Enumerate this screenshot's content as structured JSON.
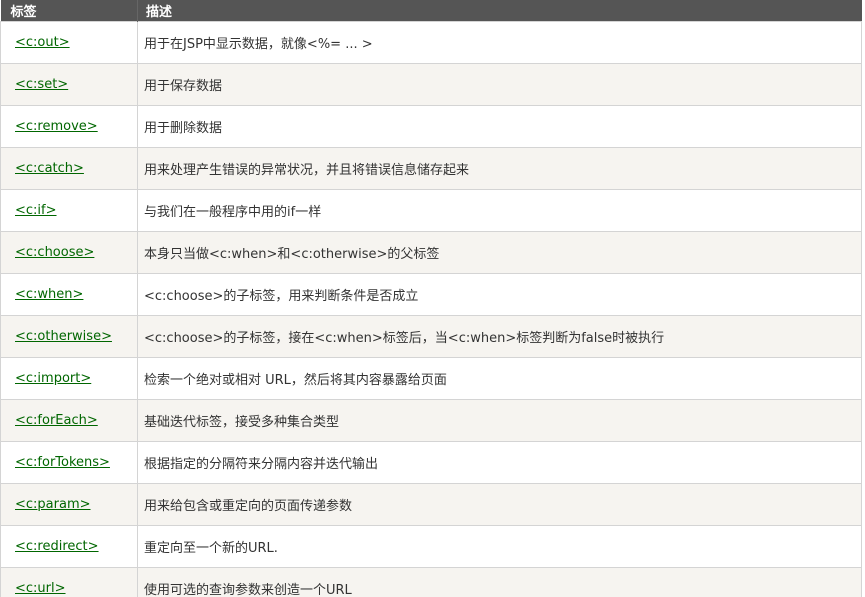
{
  "header": {
    "col_tag": "标签",
    "col_desc": "描述"
  },
  "rows": [
    {
      "tag": "<c:out>",
      "desc": "用于在JSP中显示数据，就像<%= ... >"
    },
    {
      "tag": "<c:set>",
      "desc": "用于保存数据"
    },
    {
      "tag": "<c:remove>",
      "desc": "用于删除数据"
    },
    {
      "tag": "<c:catch>",
      "desc": "用来处理产生错误的异常状况，并且将错误信息储存起来"
    },
    {
      "tag": "<c:if>",
      "desc": "与我们在一般程序中用的if一样"
    },
    {
      "tag": "<c:choose>",
      "desc": "本身只当做<c:when>和<c:otherwise>的父标签"
    },
    {
      "tag": "<c:when>",
      "desc": "<c:choose>的子标签，用来判断条件是否成立"
    },
    {
      "tag": "<c:otherwise>",
      "desc": "<c:choose>的子标签，接在<c:when>标签后，当<c:when>标签判断为false时被执行"
    },
    {
      "tag": "<c:import>",
      "desc": "检索一个绝对或相对 URL，然后将其内容暴露给页面"
    },
    {
      "tag": "<c:forEach>",
      "desc": "基础迭代标签，接受多种集合类型"
    },
    {
      "tag": "<c:forTokens>",
      "desc": "根据指定的分隔符来分隔内容并迭代输出"
    },
    {
      "tag": "<c:param>",
      "desc": "用来给包含或重定向的页面传递参数"
    },
    {
      "tag": "<c:redirect>",
      "desc": "重定向至一个新的URL."
    },
    {
      "tag": "<c:url>",
      "desc": "使用可选的查询参数来创造一个URL"
    }
  ],
  "colors": {
    "header_bg": "#555555",
    "link": "#006600",
    "row_alt": "#f6f4f0"
  }
}
